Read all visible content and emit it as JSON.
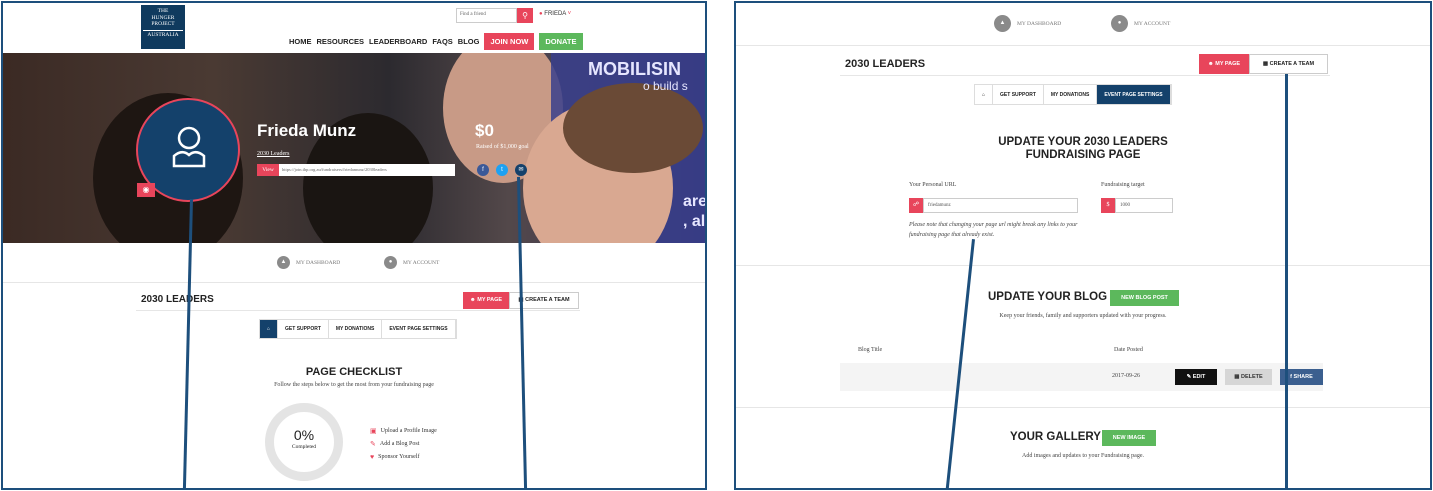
{
  "left": {
    "logo": {
      "line1": "THE",
      "line2": "HUNGER",
      "line3": "PROJECT",
      "line4": "AUSTRALIA"
    },
    "find_placeholder": "Find a friend",
    "user_label": "FRIEDA",
    "nav": [
      "HOME",
      "RESOURCES",
      "LEADERBOARD",
      "FAQS",
      "BLOG"
    ],
    "join_label": "JOIN NOW",
    "donate_label": "DONATE",
    "banner": {
      "line1": "MOBILISIN",
      "line2": "o build s",
      "line3": "are",
      "line4": ", all"
    },
    "profile": {
      "name": "Frieda Munz",
      "team": "2030 Leaders",
      "view_label": "View",
      "url": "https://join.thp.org.au/fundraisers/friedamunz/2030leaders",
      "amount": "$0",
      "raised": "Raised of $1,000 goal"
    },
    "account": {
      "dashboard": "MY DASHBOARD",
      "account": "MY ACCOUNT"
    },
    "section_title": "2030 LEADERS",
    "my_page": "MY PAGE",
    "create_team": "CREATE A TEAM",
    "tabs": [
      "GET SUPPORT",
      "MY DONATIONS",
      "EVENT PAGE SETTINGS"
    ],
    "checklist": {
      "title": "PAGE CHECKLIST",
      "subtitle": "Follow the steps below to get the most from your fundraising page",
      "percent": "0%",
      "completed": "Completed",
      "items": [
        "Upload a Profile Image",
        "Add a Blog Post",
        "Sponsor Yourself"
      ]
    }
  },
  "right": {
    "account": {
      "dashboard": "MY DASHBOARD",
      "account": "MY ACCOUNT"
    },
    "section_title": "2030 LEADERS",
    "my_page": "MY PAGE",
    "create_team": "CREATE A TEAM",
    "tabs": [
      "GET SUPPORT",
      "MY DONATIONS",
      "EVENT PAGE SETTINGS"
    ],
    "update": {
      "title_line1": "UPDATE YOUR 2030 LEADERS",
      "title_line2": "FUNDRAISING PAGE",
      "url_label": "Your Personal URL",
      "url_value": "friedamunz",
      "target_label": "Fundraising target",
      "target_value": "1000",
      "note": "Please note that changing your page url might break any links to your fundraising page that already exist."
    },
    "blog": {
      "title": "UPDATE YOUR BLOG",
      "new_post": "NEW BLOG POST",
      "subtitle": "Keep your friends, family and supporters updated with your progress.",
      "col_title": "Blog Title",
      "col_date": "Date Posted",
      "row_date": "2017-09-26",
      "edit": "EDIT",
      "delete": "DELETE",
      "share": "SHARE"
    },
    "gallery": {
      "title": "YOUR GALLERY",
      "new_image": "NEW IMAGE",
      "subtitle": "Add images and updates to your Fundraising page."
    }
  },
  "colors": {
    "brand_navy": "#14416b",
    "accent_pink": "#e8455b",
    "green": "#5cb85c",
    "share_blue": "#3b5f8f",
    "frame_blue": "#1d4f7c"
  }
}
